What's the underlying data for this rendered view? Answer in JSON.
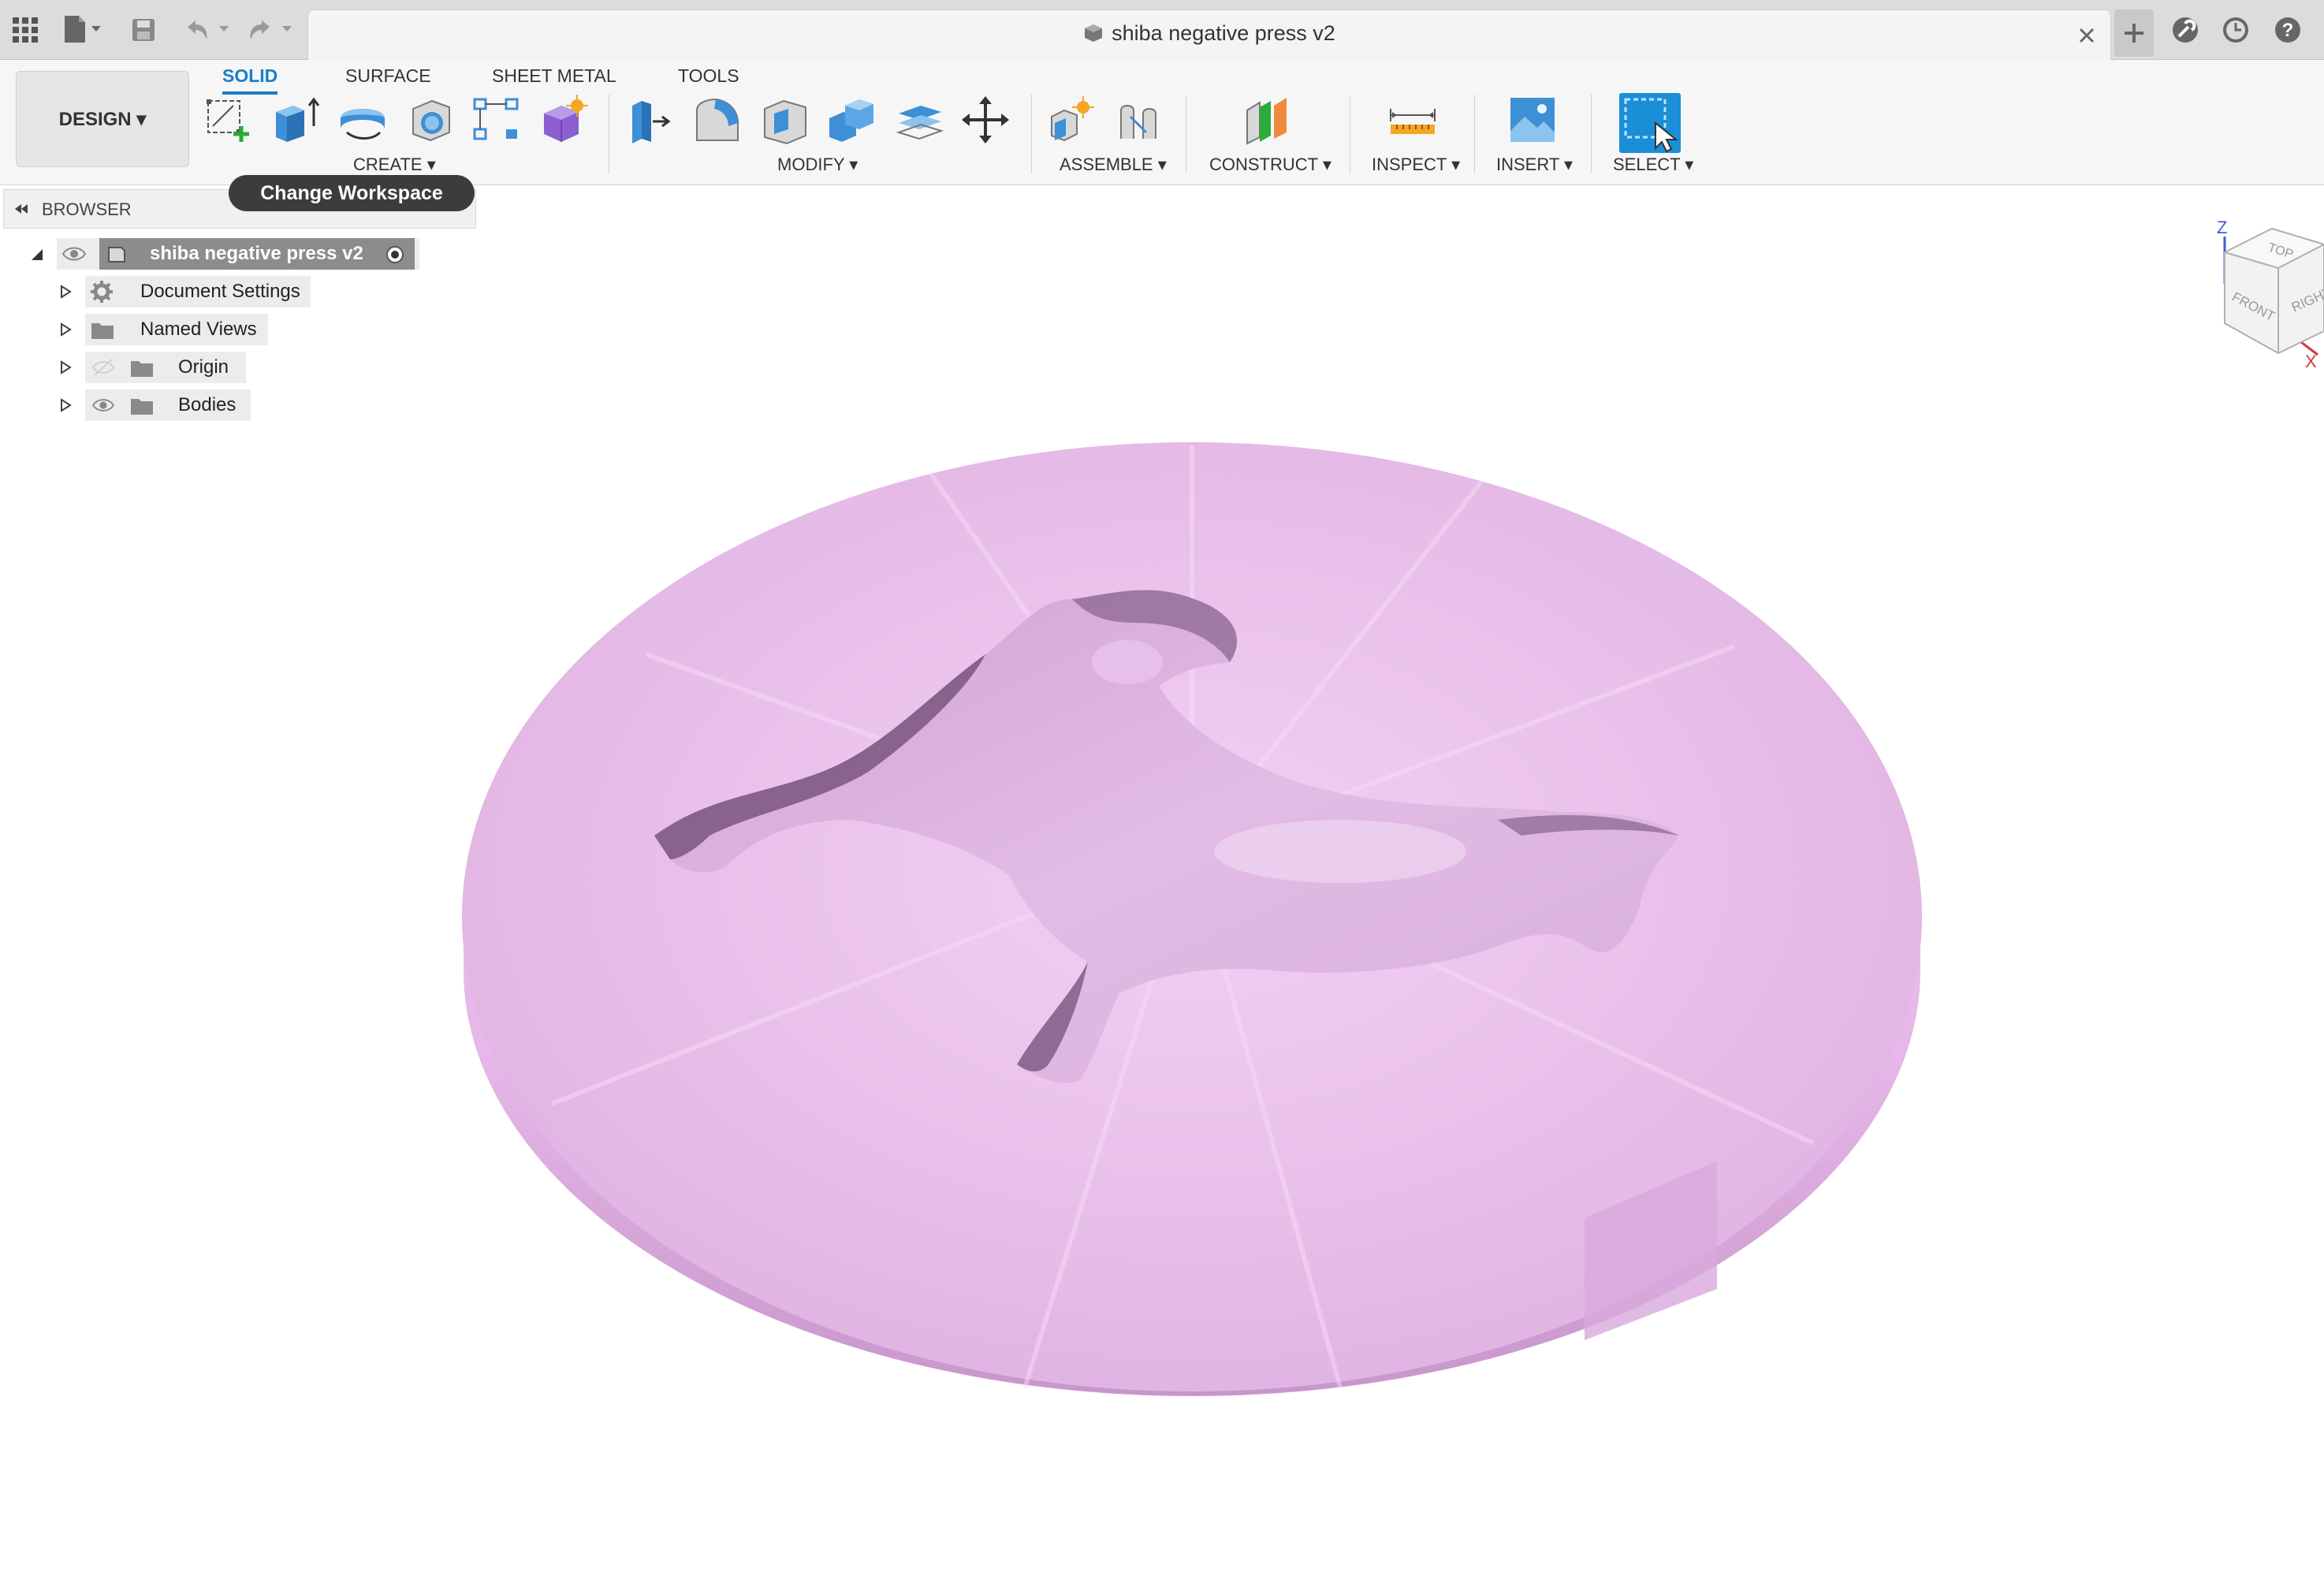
{
  "window": {
    "document_title": "shiba negative press v2"
  },
  "toolbar": {
    "workspace_button": "DESIGN ▾",
    "tabs": [
      {
        "label": "SOLID",
        "active": true
      },
      {
        "label": "SURFACE",
        "active": false
      },
      {
        "label": "SHEET METAL",
        "active": false
      },
      {
        "label": "TOOLS",
        "active": false
      }
    ],
    "groups": {
      "create": "CREATE ▾",
      "modify": "MODIFY ▾",
      "assemble": "ASSEMBLE ▾",
      "construct": "CONSTRUCT ▾",
      "inspect": "INSPECT ▾",
      "insert": "INSERT ▾",
      "select": "SELECT ▾"
    }
  },
  "tooltip": {
    "text": "Change Workspace"
  },
  "browser": {
    "title": "BROWSER",
    "root": "shiba negative press v2",
    "items": [
      {
        "label": "Document Settings",
        "icon": "gear-icon"
      },
      {
        "label": "Named Views",
        "icon": "folder-icon"
      },
      {
        "label": "Origin",
        "icon": "folder-icon"
      },
      {
        "label": "Bodies",
        "icon": "folder-icon"
      }
    ]
  },
  "viewcube": {
    "top": "TOP",
    "front": "FRONT",
    "right": "RIGHT",
    "axis_z": "Z",
    "axis_x": "X"
  },
  "colors": {
    "accent": "#1a7dc8",
    "model": "#ebc3ec",
    "tooltip_bg": "#3c3c3c"
  }
}
